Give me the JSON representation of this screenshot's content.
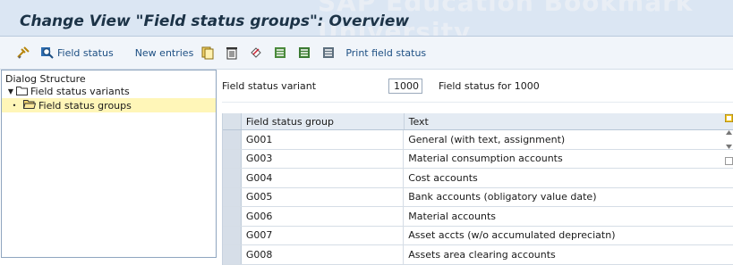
{
  "header": {
    "title": "Change View \"Field status groups\": Overview",
    "watermark": "SAP Education Bookmark University"
  },
  "toolbar": {
    "field_status_label": "Field status",
    "new_entries_label": "New entries",
    "print_label": "Print field status"
  },
  "dialog": {
    "title": "Dialog Structure",
    "items": [
      {
        "label": "Field status variants"
      },
      {
        "label": "Field status groups"
      }
    ]
  },
  "variant": {
    "label": "Field status variant",
    "value": "1000",
    "description": "Field status for 1000"
  },
  "table": {
    "columns": [
      "Field status group",
      "Text"
    ],
    "rows": [
      {
        "group": "G001",
        "text": "General (with text, assignment)"
      },
      {
        "group": "G003",
        "text": "Material consumption accounts"
      },
      {
        "group": "G004",
        "text": "Cost accounts"
      },
      {
        "group": "G005",
        "text": "Bank accounts (obligatory value date)"
      },
      {
        "group": "G006",
        "text": "Material accounts"
      },
      {
        "group": "G007",
        "text": "Asset accts (w/o accumulated depreciatn)"
      },
      {
        "group": "G008",
        "text": "Assets area clearing accounts"
      }
    ]
  },
  "colors": {
    "title_bg": "#dbe6f3",
    "selected_tree_bg": "#fff6b8",
    "link_blue": "#1d4f83"
  }
}
